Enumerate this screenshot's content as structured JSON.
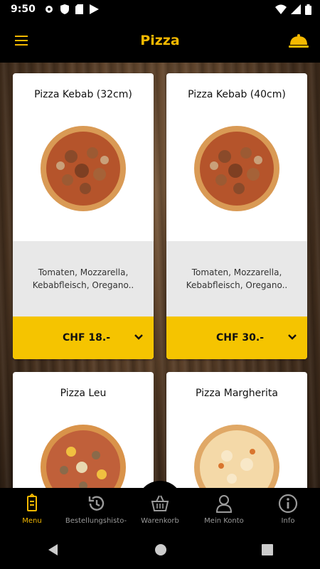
{
  "status_bar": {
    "time": "9:50"
  },
  "app_bar": {
    "title": "Pizza"
  },
  "products": [
    {
      "name": "Pizza Kebab (32cm)",
      "description_line1": "Tomaten, Mozzarella,",
      "description_line2": "Kebabfleisch, Oregano..",
      "price": "CHF 18.-"
    },
    {
      "name": "Pizza Kebab (40cm)",
      "description_line1": "Tomaten, Mozzarella,",
      "description_line2": "Kebabfleisch, Oregano..",
      "price": "CHF 30.-"
    },
    {
      "name": "Pizza Leu"
    },
    {
      "name": "Pizza Margherita"
    }
  ],
  "bottom_nav": {
    "items": [
      {
        "label": "Menu",
        "icon": "menu-board-icon",
        "active": true
      },
      {
        "label": "Bestellungshisto-",
        "icon": "history-icon"
      },
      {
        "label": "Warenkorb",
        "icon": "basket-icon"
      },
      {
        "label": "Mein Konto",
        "icon": "user-icon"
      },
      {
        "label": "Info",
        "icon": "info-icon"
      }
    ]
  },
  "colors": {
    "accent": "#f5c400",
    "title": "#f5b900",
    "background": "#000000"
  }
}
